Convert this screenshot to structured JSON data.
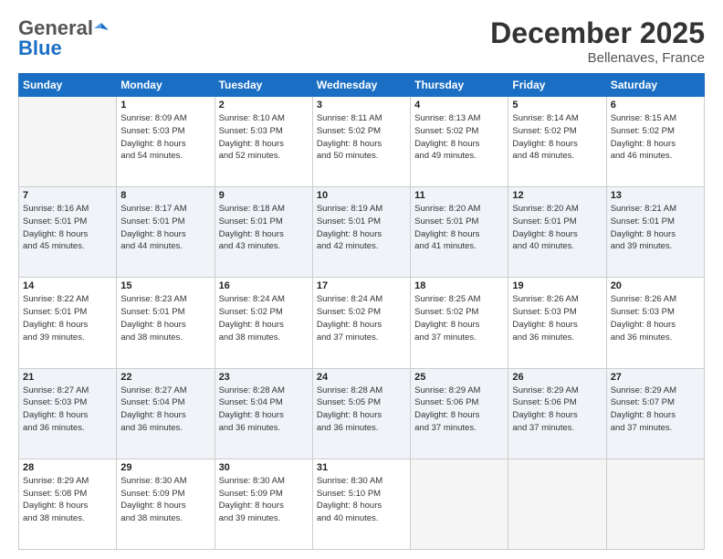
{
  "header": {
    "logo_general": "General",
    "logo_blue": "Blue",
    "month_title": "December 2025",
    "location": "Bellenaves, France"
  },
  "days_of_week": [
    "Sunday",
    "Monday",
    "Tuesday",
    "Wednesday",
    "Thursday",
    "Friday",
    "Saturday"
  ],
  "weeks": [
    [
      {
        "day": "",
        "content": ""
      },
      {
        "day": "1",
        "content": "Sunrise: 8:09 AM\nSunset: 5:03 PM\nDaylight: 8 hours\nand 54 minutes."
      },
      {
        "day": "2",
        "content": "Sunrise: 8:10 AM\nSunset: 5:03 PM\nDaylight: 8 hours\nand 52 minutes."
      },
      {
        "day": "3",
        "content": "Sunrise: 8:11 AM\nSunset: 5:02 PM\nDaylight: 8 hours\nand 50 minutes."
      },
      {
        "day": "4",
        "content": "Sunrise: 8:13 AM\nSunset: 5:02 PM\nDaylight: 8 hours\nand 49 minutes."
      },
      {
        "day": "5",
        "content": "Sunrise: 8:14 AM\nSunset: 5:02 PM\nDaylight: 8 hours\nand 48 minutes."
      },
      {
        "day": "6",
        "content": "Sunrise: 8:15 AM\nSunset: 5:02 PM\nDaylight: 8 hours\nand 46 minutes."
      }
    ],
    [
      {
        "day": "7",
        "content": "Sunrise: 8:16 AM\nSunset: 5:01 PM\nDaylight: 8 hours\nand 45 minutes."
      },
      {
        "day": "8",
        "content": "Sunrise: 8:17 AM\nSunset: 5:01 PM\nDaylight: 8 hours\nand 44 minutes."
      },
      {
        "day": "9",
        "content": "Sunrise: 8:18 AM\nSunset: 5:01 PM\nDaylight: 8 hours\nand 43 minutes."
      },
      {
        "day": "10",
        "content": "Sunrise: 8:19 AM\nSunset: 5:01 PM\nDaylight: 8 hours\nand 42 minutes."
      },
      {
        "day": "11",
        "content": "Sunrise: 8:20 AM\nSunset: 5:01 PM\nDaylight: 8 hours\nand 41 minutes."
      },
      {
        "day": "12",
        "content": "Sunrise: 8:20 AM\nSunset: 5:01 PM\nDaylight: 8 hours\nand 40 minutes."
      },
      {
        "day": "13",
        "content": "Sunrise: 8:21 AM\nSunset: 5:01 PM\nDaylight: 8 hours\nand 39 minutes."
      }
    ],
    [
      {
        "day": "14",
        "content": "Sunrise: 8:22 AM\nSunset: 5:01 PM\nDaylight: 8 hours\nand 39 minutes."
      },
      {
        "day": "15",
        "content": "Sunrise: 8:23 AM\nSunset: 5:01 PM\nDaylight: 8 hours\nand 38 minutes."
      },
      {
        "day": "16",
        "content": "Sunrise: 8:24 AM\nSunset: 5:02 PM\nDaylight: 8 hours\nand 38 minutes."
      },
      {
        "day": "17",
        "content": "Sunrise: 8:24 AM\nSunset: 5:02 PM\nDaylight: 8 hours\nand 37 minutes."
      },
      {
        "day": "18",
        "content": "Sunrise: 8:25 AM\nSunset: 5:02 PM\nDaylight: 8 hours\nand 37 minutes."
      },
      {
        "day": "19",
        "content": "Sunrise: 8:26 AM\nSunset: 5:03 PM\nDaylight: 8 hours\nand 36 minutes."
      },
      {
        "day": "20",
        "content": "Sunrise: 8:26 AM\nSunset: 5:03 PM\nDaylight: 8 hours\nand 36 minutes."
      }
    ],
    [
      {
        "day": "21",
        "content": "Sunrise: 8:27 AM\nSunset: 5:03 PM\nDaylight: 8 hours\nand 36 minutes."
      },
      {
        "day": "22",
        "content": "Sunrise: 8:27 AM\nSunset: 5:04 PM\nDaylight: 8 hours\nand 36 minutes."
      },
      {
        "day": "23",
        "content": "Sunrise: 8:28 AM\nSunset: 5:04 PM\nDaylight: 8 hours\nand 36 minutes."
      },
      {
        "day": "24",
        "content": "Sunrise: 8:28 AM\nSunset: 5:05 PM\nDaylight: 8 hours\nand 36 minutes."
      },
      {
        "day": "25",
        "content": "Sunrise: 8:29 AM\nSunset: 5:06 PM\nDaylight: 8 hours\nand 37 minutes."
      },
      {
        "day": "26",
        "content": "Sunrise: 8:29 AM\nSunset: 5:06 PM\nDaylight: 8 hours\nand 37 minutes."
      },
      {
        "day": "27",
        "content": "Sunrise: 8:29 AM\nSunset: 5:07 PM\nDaylight: 8 hours\nand 37 minutes."
      }
    ],
    [
      {
        "day": "28",
        "content": "Sunrise: 8:29 AM\nSunset: 5:08 PM\nDaylight: 8 hours\nand 38 minutes."
      },
      {
        "day": "29",
        "content": "Sunrise: 8:30 AM\nSunset: 5:09 PM\nDaylight: 8 hours\nand 38 minutes."
      },
      {
        "day": "30",
        "content": "Sunrise: 8:30 AM\nSunset: 5:09 PM\nDaylight: 8 hours\nand 39 minutes."
      },
      {
        "day": "31",
        "content": "Sunrise: 8:30 AM\nSunset: 5:10 PM\nDaylight: 8 hours\nand 40 minutes."
      },
      {
        "day": "",
        "content": ""
      },
      {
        "day": "",
        "content": ""
      },
      {
        "day": "",
        "content": ""
      }
    ]
  ]
}
